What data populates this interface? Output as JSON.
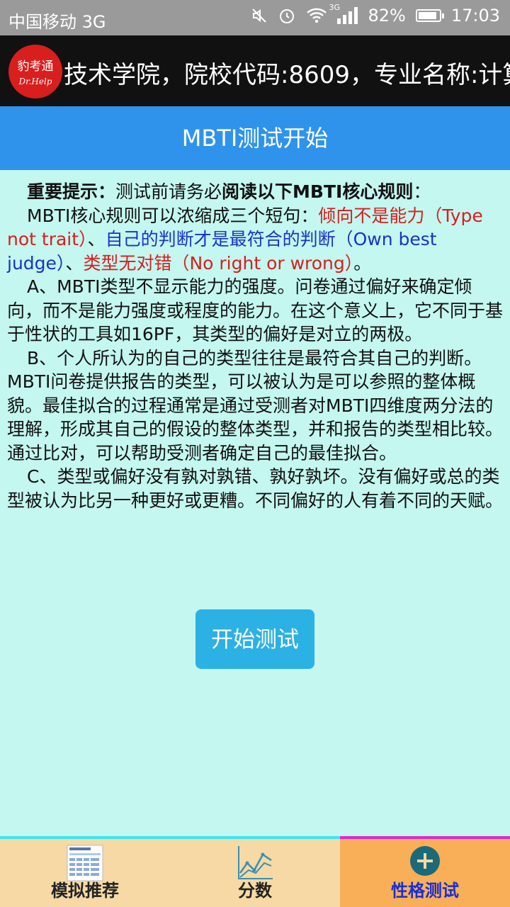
{
  "status_bar": {
    "carrier": "中国移动 3G",
    "network_badge": "3G",
    "battery": "82%",
    "time": "17:03"
  },
  "banner": {
    "logo_text": "豹考通",
    "logo_sub": "Dr.Help",
    "scroll_text": "技术学院，院校代码:8609，专业名称:计算"
  },
  "title": "MBTI测试开始",
  "content": {
    "tip_label": "重要提示：",
    "tip_text": "测试前请务必",
    "tip_bold": "阅读以下MBTI核心规则",
    "tip_end": "：",
    "rules_intro": "MBTI核心规则可以浓缩成三个短句：",
    "rule1": "倾向不是能力（Type not trait）",
    "sep1": "、",
    "rule2": "自己的判断才是最符合的判断（Own best judge）",
    "sep2": "、",
    "rule3": "类型无对错（No right or wrong）",
    "rules_end": "。",
    "para_a": "A、MBTI类型不显示能力的强度。问卷通过偏好来确定倾向，而不是能力强度或程度的能力。在这个意义上，它不同于基于性状的工具如16PF，其类型的偏好是对立的两极。",
    "para_b": "B、个人所认为的自己的类型往往是最符合其自己的判断。MBTI问卷提供报告的类型，可以被认为是可以参照的整体概貌。最佳拟合的过程通常是通过受测者对MBTI四维度两分法的理解，形成其自己的假设的整体类型，并和报告的类型相比较。通过比对，可以帮助受测者确定自己的最佳拟合。",
    "para_c": "C、类型或偏好没有孰对孰错、孰好孰坏。没有偏好或总的类型被认为比另一种更好或更糟。不同偏好的人有着不同的天赋。"
  },
  "start_button": "开始测试",
  "tabs": [
    {
      "label": "模拟推荐",
      "icon": "table-thumbnail-icon",
      "active": false
    },
    {
      "label": "分数",
      "icon": "line-chart-icon",
      "active": false
    },
    {
      "label": "性格测试",
      "icon": "plus-circle-icon",
      "active": true
    }
  ],
  "colors": {
    "background": "#c3f7ef",
    "title_bar": "#2f93ec",
    "red_text": "#d91e1e",
    "blue_text": "#1a32c8",
    "button": "#2cb1e4",
    "active_tab": "#f9ae58"
  }
}
